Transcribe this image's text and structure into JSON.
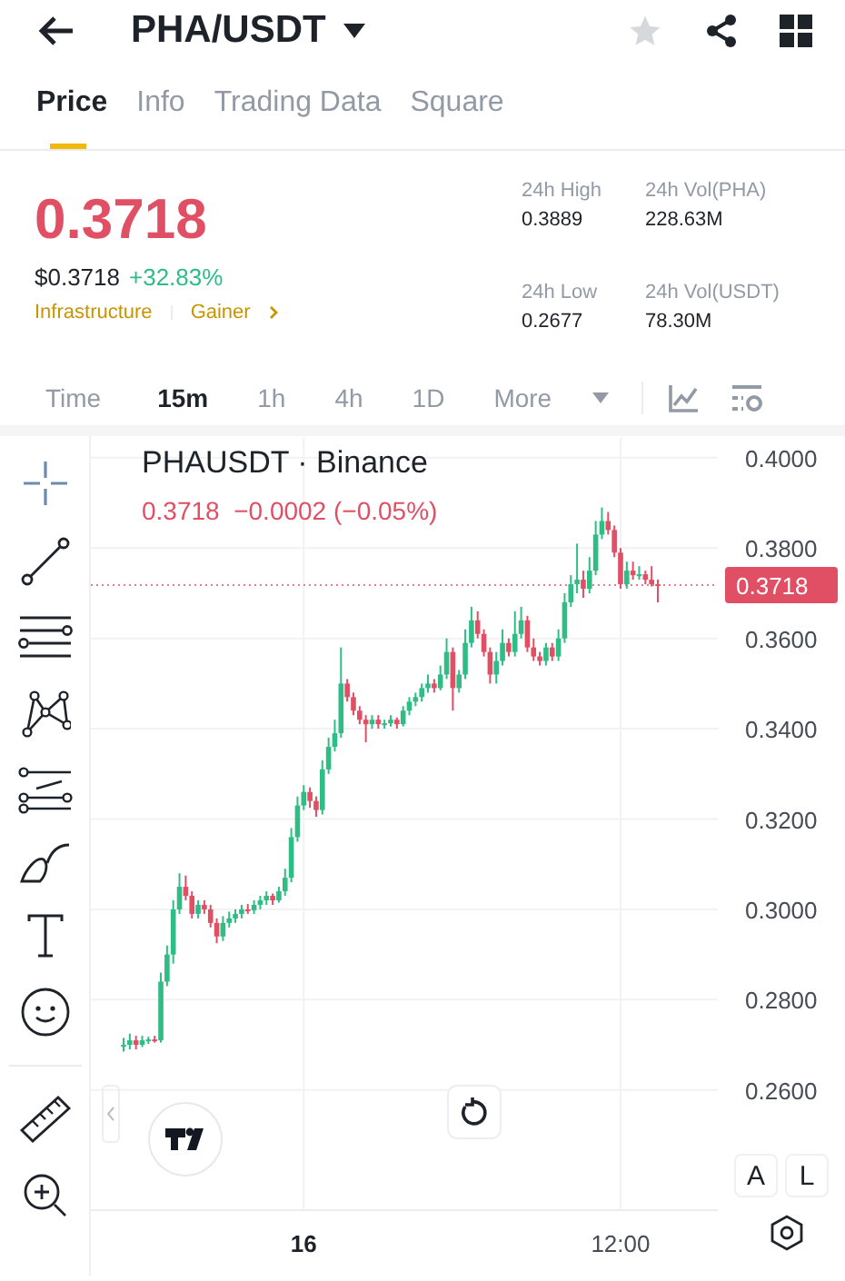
{
  "header": {
    "title": "PHA/USDT",
    "favorite": false
  },
  "tabs": [
    {
      "label": "Price",
      "selected": true
    },
    {
      "label": "Info",
      "selected": false
    },
    {
      "label": "Trading Data",
      "selected": false
    },
    {
      "label": "Square",
      "selected": false
    }
  ],
  "price": {
    "last": "0.3718",
    "usd": "$0.3718",
    "change": "+32.83%",
    "tags": [
      "Infrastructure",
      "Gainer"
    ]
  },
  "stats": [
    {
      "label": "24h High",
      "value": "0.3889"
    },
    {
      "label": "24h Vol(PHA)",
      "value": "228.63M"
    },
    {
      "label": "24h Low",
      "value": "0.2677"
    },
    {
      "label": "24h Vol(USDT)",
      "value": "78.30M"
    }
  ],
  "intervals": [
    {
      "label": "Time",
      "selected": false
    },
    {
      "label": "15m",
      "selected": true
    },
    {
      "label": "1h",
      "selected": false
    },
    {
      "label": "4h",
      "selected": false
    },
    {
      "label": "1D",
      "selected": false
    }
  ],
  "more": "More",
  "chart": {
    "ohlc_readout": "0.3718  −0.0002 (−0.05%)",
    "scale_buttons": [
      "A",
      "L"
    ],
    "chart_data": {
      "type": "candlestick",
      "title": "PHAUSDT · Binance",
      "grid": true,
      "ylim": [
        0.2334,
        0.4044
      ],
      "yticks": [
        {
          "value": 0.26,
          "label": "0.2600"
        },
        {
          "value": 0.28,
          "label": "0.2800"
        },
        {
          "value": 0.3,
          "label": "0.3000"
        },
        {
          "value": 0.32,
          "label": "0.3200"
        },
        {
          "value": 0.34,
          "label": "0.3400"
        },
        {
          "value": 0.36,
          "label": "0.3600"
        },
        {
          "value": 0.38,
          "label": "0.3800"
        },
        {
          "value": 0.4,
          "label": "0.4000"
        }
      ],
      "ref_lines": [
        {
          "axis": "y",
          "value": 0.3718,
          "label": "0.3718"
        }
      ],
      "categories": [
        null,
        null,
        null,
        null,
        null,
        null,
        null,
        null,
        null,
        null,
        null,
        null,
        null,
        null,
        null,
        null,
        null,
        null,
        null,
        null,
        null,
        null,
        null,
        null,
        null,
        null,
        null,
        null,
        null,
        "16",
        null,
        null,
        null,
        null,
        null,
        null,
        null,
        null,
        null,
        null,
        null,
        null,
        null,
        null,
        null,
        null,
        null,
        null,
        null,
        null,
        null,
        null,
        null,
        null,
        null,
        null,
        null,
        null,
        null,
        null,
        null,
        null,
        null,
        null,
        null,
        null,
        null,
        null,
        null,
        null,
        null,
        null,
        null,
        null,
        null,
        null,
        null,
        null,
        null,
        null,
        "12:00",
        null,
        null,
        null,
        null,
        null,
        null
      ],
      "ohlc": [
        [
          0.27,
          0.2715,
          0.2685,
          0.27
        ],
        [
          0.27,
          0.2725,
          0.269,
          0.271
        ],
        [
          0.271,
          0.272,
          0.269,
          0.27
        ],
        [
          0.27,
          0.272,
          0.2695,
          0.271
        ],
        [
          0.271,
          0.2718,
          0.2702,
          0.2712
        ],
        [
          0.2712,
          0.272,
          0.2705,
          0.271
        ],
        [
          0.271,
          0.286,
          0.2705,
          0.284
        ],
        [
          0.284,
          0.292,
          0.283,
          0.29
        ],
        [
          0.29,
          0.302,
          0.288,
          0.3
        ],
        [
          0.3,
          0.308,
          0.299,
          0.305
        ],
        [
          0.305,
          0.3075,
          0.302,
          0.303
        ],
        [
          0.303,
          0.304,
          0.298,
          0.299
        ],
        [
          0.299,
          0.302,
          0.298,
          0.301
        ],
        [
          0.301,
          0.302,
          0.299,
          0.3
        ],
        [
          0.3,
          0.301,
          0.296,
          0.297
        ],
        [
          0.297,
          0.298,
          0.2925,
          0.294
        ],
        [
          0.294,
          0.2985,
          0.293,
          0.297
        ],
        [
          0.297,
          0.2995,
          0.296,
          0.298
        ],
        [
          0.298,
          0.3,
          0.297,
          0.299
        ],
        [
          0.299,
          0.301,
          0.298,
          0.3
        ],
        [
          0.3,
          0.3012,
          0.299,
          0.2998
        ],
        [
          0.2998,
          0.302,
          0.299,
          0.301
        ],
        [
          0.301,
          0.303,
          0.3,
          0.302
        ],
        [
          0.302,
          0.304,
          0.301,
          0.303
        ],
        [
          0.303,
          0.3035,
          0.301,
          0.302
        ],
        [
          0.302,
          0.305,
          0.3015,
          0.304
        ],
        [
          0.304,
          0.309,
          0.303,
          0.307
        ],
        [
          0.307,
          0.318,
          0.306,
          0.316
        ],
        [
          0.316,
          0.325,
          0.315,
          0.323
        ],
        [
          0.323,
          0.3275,
          0.322,
          0.326
        ],
        [
          0.326,
          0.327,
          0.3225,
          0.324
        ],
        [
          0.324,
          0.325,
          0.3205,
          0.322
        ],
        [
          0.322,
          0.333,
          0.321,
          0.331
        ],
        [
          0.331,
          0.338,
          0.33,
          0.336
        ],
        [
          0.336,
          0.342,
          0.335,
          0.339
        ],
        [
          0.339,
          0.358,
          0.338,
          0.35
        ],
        [
          0.35,
          0.351,
          0.346,
          0.347
        ],
        [
          0.347,
          0.348,
          0.343,
          0.344
        ],
        [
          0.344,
          0.345,
          0.341,
          0.342
        ],
        [
          0.342,
          0.343,
          0.337,
          0.341
        ],
        [
          0.341,
          0.343,
          0.34,
          0.342
        ],
        [
          0.342,
          0.343,
          0.34,
          0.341
        ],
        [
          0.341,
          0.342,
          0.34,
          0.3412
        ],
        [
          0.3412,
          0.343,
          0.3405,
          0.342
        ],
        [
          0.342,
          0.3425,
          0.34,
          0.341
        ],
        [
          0.341,
          0.345,
          0.3405,
          0.344
        ],
        [
          0.344,
          0.347,
          0.343,
          0.346
        ],
        [
          0.346,
          0.348,
          0.345,
          0.347
        ],
        [
          0.347,
          0.35,
          0.346,
          0.349
        ],
        [
          0.349,
          0.352,
          0.348,
          0.35
        ],
        [
          0.35,
          0.351,
          0.348,
          0.349
        ],
        [
          0.349,
          0.354,
          0.3485,
          0.352
        ],
        [
          0.352,
          0.36,
          0.351,
          0.357
        ],
        [
          0.357,
          0.358,
          0.344,
          0.349
        ],
        [
          0.349,
          0.353,
          0.348,
          0.352
        ],
        [
          0.352,
          0.362,
          0.351,
          0.359
        ],
        [
          0.359,
          0.367,
          0.358,
          0.364
        ],
        [
          0.364,
          0.366,
          0.36,
          0.361
        ],
        [
          0.361,
          0.362,
          0.356,
          0.357
        ],
        [
          0.357,
          0.358,
          0.35,
          0.352
        ],
        [
          0.352,
          0.357,
          0.35,
          0.355
        ],
        [
          0.355,
          0.362,
          0.354,
          0.359
        ],
        [
          0.359,
          0.36,
          0.356,
          0.357
        ],
        [
          0.357,
          0.366,
          0.356,
          0.361
        ],
        [
          0.361,
          0.367,
          0.36,
          0.364
        ],
        [
          0.364,
          0.365,
          0.357,
          0.358
        ],
        [
          0.358,
          0.36,
          0.355,
          0.356
        ],
        [
          0.356,
          0.357,
          0.354,
          0.355
        ],
        [
          0.355,
          0.359,
          0.354,
          0.358
        ],
        [
          0.358,
          0.359,
          0.355,
          0.356
        ],
        [
          0.356,
          0.362,
          0.355,
          0.36
        ],
        [
          0.36,
          0.37,
          0.359,
          0.368
        ],
        [
          0.368,
          0.374,
          0.367,
          0.372
        ],
        [
          0.372,
          0.381,
          0.37,
          0.373
        ],
        [
          0.373,
          0.375,
          0.369,
          0.371
        ],
        [
          0.371,
          0.378,
          0.37,
          0.375
        ],
        [
          0.375,
          0.386,
          0.374,
          0.383
        ],
        [
          0.383,
          0.389,
          0.382,
          0.386
        ],
        [
          0.386,
          0.388,
          0.383,
          0.384
        ],
        [
          0.384,
          0.385,
          0.378,
          0.379
        ],
        [
          0.379,
          0.38,
          0.371,
          0.372
        ],
        [
          0.372,
          0.377,
          0.371,
          0.375
        ],
        [
          0.375,
          0.377,
          0.373,
          0.374
        ],
        [
          0.374,
          0.376,
          0.373,
          0.3742
        ],
        [
          0.3742,
          0.375,
          0.372,
          0.373
        ],
        [
          0.373,
          0.376,
          0.3715,
          0.372
        ],
        [
          0.372,
          0.373,
          0.368,
          0.3718
        ]
      ]
    }
  }
}
